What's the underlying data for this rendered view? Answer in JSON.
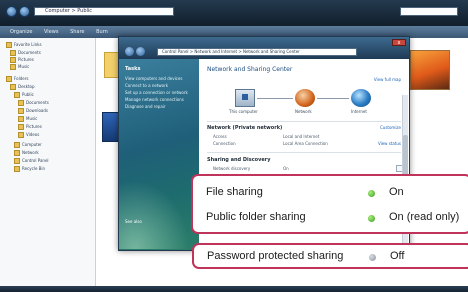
{
  "explorer": {
    "address_text": "Computer > Public",
    "toolbar_items": [
      "Organize",
      "Views",
      "Share",
      "Burn"
    ],
    "nav_items": [
      "Favorite Links",
      "Documents",
      "Pictures",
      "Music",
      "Folders",
      "Desktop",
      "Public",
      "Documents",
      "Downloads",
      "Music",
      "Pictures",
      "Videos",
      "Computer",
      "Network",
      "Control Panel",
      "Recycle Bin"
    ]
  },
  "ns_window": {
    "close_label": "x",
    "address_text": "Control Panel > Network and Internet > Network and Sharing Center",
    "tasks_heading": "Tasks",
    "tasks": [
      "View computers and devices",
      "Connect to a network",
      "Set up a connection or network",
      "Manage network connections",
      "Diagnose and repair"
    ],
    "see_also": "See also",
    "title": "Network and Sharing Center",
    "view_full_map": "View full map",
    "nodes": {
      "computer": "This computer",
      "network": "Network",
      "internet": "Internet"
    },
    "network_heading": "Network (Private network)",
    "access_label": "Access",
    "access_value": "Local and Internet",
    "connection_label": "Connection",
    "connection_value": "Local Area Connection",
    "customize_link": "Customize",
    "view_status_link": "View status",
    "sharing_heading": "Sharing and Discovery",
    "network_discovery_label": "Network discovery",
    "network_discovery_value": "On"
  },
  "callouts": {
    "file_sharing_label": "File sharing",
    "file_sharing_status": "On",
    "public_folder_label": "Public folder sharing",
    "public_folder_status": "On (read only)",
    "password_label": "Password protected sharing",
    "password_status": "Off"
  },
  "colors": {
    "callout_border": "#c0335a",
    "status_on": "#3a9a1f",
    "status_off": "#8a939c",
    "task_pane": "#1f5f79"
  }
}
